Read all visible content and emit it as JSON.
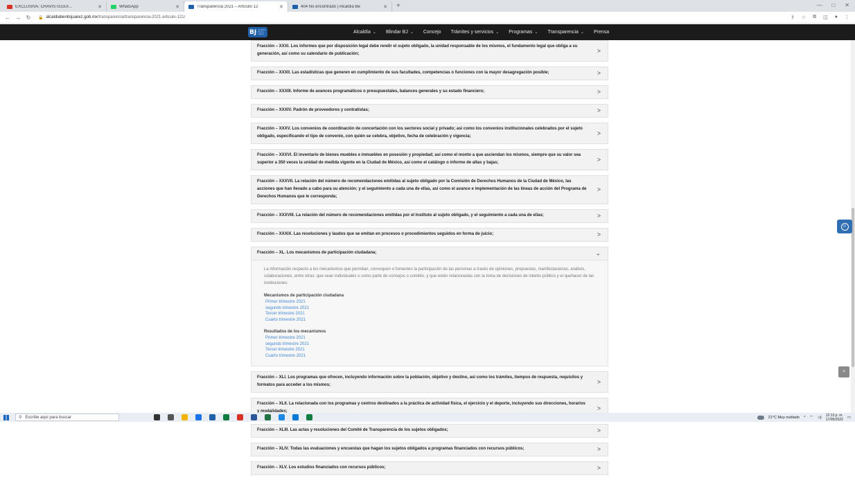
{
  "browser": {
    "tabs": [
      {
        "label": "EXCLUSIVA: CHAVISTEGUI...",
        "color": "#d93025",
        "active": false
      },
      {
        "label": "WhatsApp",
        "color": "#25d366",
        "active": false
      },
      {
        "label": "Transparencia 2021 – Artículo 12",
        "color": "#1e5fa8",
        "active": true
      },
      {
        "label": "404 No encontrado | Alcaldía Be",
        "color": "#1e5fa8",
        "active": false
      }
    ],
    "new_tab": "+",
    "url_host": "alcaldiabenitojuarez.gob.mx",
    "url_path": "/transparencia/transparencia-2021-articulo-121/"
  },
  "site": {
    "logo_text": "BJ",
    "logo_sub": "Alcaldía Benito Juárez",
    "nav": [
      {
        "label": "Alcaldía",
        "dropdown": true
      },
      {
        "label": "Blindar BJ",
        "dropdown": true
      },
      {
        "label": "Concejo",
        "dropdown": false
      },
      {
        "label": "Trámites y servicios",
        "dropdown": true
      },
      {
        "label": "Programas",
        "dropdown": true
      },
      {
        "label": "Transparencia",
        "dropdown": true
      },
      {
        "label": "Prensa",
        "dropdown": false
      }
    ]
  },
  "fractions_before": [
    "Fracción – XXXI. Los informes que por disposición legal debe rendir el sujeto obligado, la unidad responsable de los mismos, el fundamento legal que obliga a su generación, así como su calendario de publicación;",
    "Fracción – XXXII. Las estadísticas que generen en cumplimiento de sus facultades, competencias o funciones con la mayor desagregación posible;",
    "Fracción – XXXIII. Informe de avances programáticos o presupuestales, balances generales y su estado financiero;",
    "Fracción – XXXIV. Padrón de proveedores y contratistas;",
    "Fracción – XXXV. Los convenios de coordinación de concertación con los sectores social y privado; así como los convenios institucionales celebrados por el sujeto obligado, especificando el tipo de convenio, con quién se celebra, objetivo, fecha de celebración y vigencia;",
    "Fracción – XXXVI. El inventario de bienes muebles e inmuebles en posesión y propiedad; así como el monto a que asciendan los mismos, siempre que su valor sea superior a 350 veces la unidad de medida vigente en la Ciudad de México, así como el catálogo o informe de altas y bajas;",
    "Fracción – XXXVII. La relación del número de recomendaciones emitidas al sujeto obligado por la Comisión de Derechos Humanos de la Ciudad de México, las acciones que han llevado a cabo para su atención; y el seguimiento a cada una de ellas, así como el avance e implementación de las líneas de acción del Programa de Derechos Humanos que le corresponda;",
    "Fracción – XXXVIII. La relación del número de recomendaciones emitidas por el Instituto al sujeto obligado, y el seguimiento a cada una de ellas;",
    "Fracción – XXXIX. Las resoluciones y laudos que se emitan en procesos o procedimientos seguidos en forma de juicio;"
  ],
  "expanded": {
    "title": "Fracción – XL. Los mecanismos de participación ciudadana;",
    "description": "La información respecto a los mecanismos que permitan, convoquen o fomenten la participación de las personas a través de opiniones, propuestas, manifestaciones, análisis, colaboraciones, entre otras; que sean individuales o como parte de consejos o comités, y que estén relacionadas con la toma de decisiones de interés público y el quehacer de las instituciones.",
    "group1_title": "Mecanismos de participación ciudadana",
    "group1_links": [
      "Primer trimestre 2021",
      "segundo trimestre 2021",
      "Tercer trimestre 2021",
      "Cuarto trimestre 2021"
    ],
    "group2_title": "Resultados de los mecanismos",
    "group2_links": [
      "Primer trimestre 2021",
      "segundo trimestre 2021",
      "Tercer trimestre 2021",
      "Cuarto trimestre 2021"
    ]
  },
  "fractions_after": [
    "Fracción – XLI. Los programas que ofrecen, incluyendo información sobre la población, objetivo y destino, así como los trámites, tiempos de respuesta, requisitos y formatos para acceder a los mismos;",
    "Fracción – XLII. La relacionada con los programas y centros destinados a la práctica de actividad física, el ejercicio y el deporte, incluyendo sus direcciones, horarios y modalidades;",
    "Fracción – XLIII. Las actas y resoluciones del Comité de Transparencia de los sujetos obligados;",
    "Fracción – XLIV. Todas las evaluaciones y encuestas que hagan los sujetos obligados a programas financiados con recursos públicos;",
    "Fracción – XLV. Los estudios financiados con recursos públicos;"
  ],
  "taskbar": {
    "search_placeholder": "Escribe aquí para buscar",
    "weather": "21°C Muy nublado",
    "time": "12:13 p. m.",
    "date": "17/05/2022",
    "app_colors": [
      "#333333",
      "#555555",
      "#f0b400",
      "#1a73e8",
      "#1e5fa8",
      "#0f7b3e",
      "#d93025",
      "#2b579a",
      "#217346",
      "#1e88e5",
      "#0078d4",
      "#107c41"
    ]
  },
  "icons": {
    "row_collapsed": ">",
    "row_expanded": "⌄",
    "accessibility": "accessibility-icon",
    "back_to_top": "^"
  }
}
